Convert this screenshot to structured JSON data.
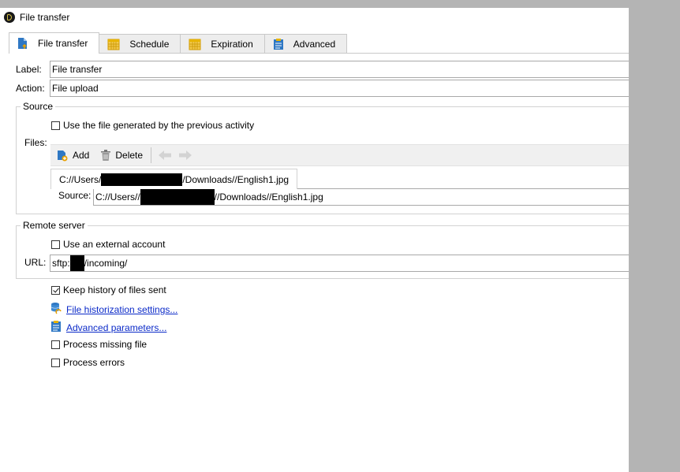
{
  "window": {
    "title": "File transfer"
  },
  "tabs": [
    {
      "label": "File transfer",
      "icon": "file-upload-icon"
    },
    {
      "label": "Schedule",
      "icon": "calendar-icon"
    },
    {
      "label": "Expiration",
      "icon": "calendar-icon"
    },
    {
      "label": "Advanced",
      "icon": "clipboard-icon"
    }
  ],
  "form": {
    "label_caption": "Label:",
    "label_value": "File transfer",
    "action_caption": "Action:",
    "action_value": "File upload"
  },
  "source": {
    "legend": "Source",
    "use_previous_label": "Use the file generated by the previous activity",
    "use_previous_checked": false,
    "files_caption": "Files:",
    "toolbar": {
      "add_label": "Add",
      "delete_label": "Delete"
    },
    "file_tab": {
      "prefix": "C://Users/",
      "suffix": "/Downloads//English1.jpg"
    },
    "source_caption": "Source:",
    "source_value": {
      "prefix": "C://Users//",
      "suffix": "//Downloads//English1.jpg"
    }
  },
  "remote": {
    "legend": "Remote server",
    "external_account_label": "Use an external account",
    "external_account_checked": false,
    "url_caption": "URL:",
    "url_prefix": "sftp:",
    "url_suffix": "/incoming/"
  },
  "options": {
    "keep_history_label": "Keep history of files sent",
    "keep_history_checked": true,
    "historization_link": "File historization settings...",
    "advanced_params_link": "Advanced parameters...",
    "process_missing_label": "Process missing file",
    "process_missing_checked": false,
    "process_errors_label": "Process errors",
    "process_errors_checked": false
  },
  "colors": {
    "link": "#0b2ac8",
    "accent_blue": "#2f78c4",
    "calendar": "#e8b400"
  }
}
